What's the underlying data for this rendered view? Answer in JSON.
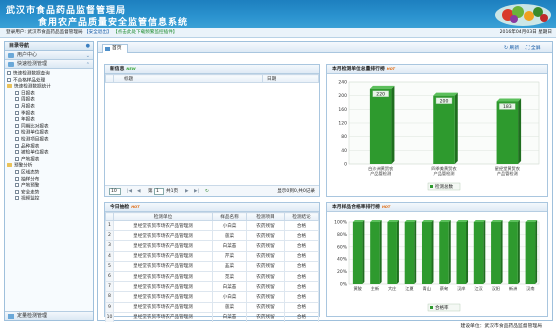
{
  "header": {
    "title_line1": "武汉市食品药品监督管理局",
    "title_line2": "食用农产品质量安全监管信息系统"
  },
  "infobar": {
    "login_user_prefix": "登录用户:",
    "login_user": "武汉市食品药品监督管理局",
    "safe_exit": "【安全退出】",
    "download_link": "【点击此处下载频繁监控插件】",
    "date": "2016年04月03日 星期日"
  },
  "sidebar": {
    "title": "目录导航",
    "user_center": "用户中心",
    "fast_manage": "快速检测管理",
    "tree": [
      {
        "label": "快速检测数据查询",
        "level": 1,
        "kind": "leaf"
      },
      {
        "label": "不合格样品处理",
        "level": 1,
        "kind": "leaf"
      },
      {
        "label": "快速检测数据统计",
        "level": 1,
        "kind": "folder"
      },
      {
        "label": "日报表",
        "level": 2,
        "kind": "leaf"
      },
      {
        "label": "周报表",
        "level": 2,
        "kind": "leaf"
      },
      {
        "label": "月报表",
        "level": 2,
        "kind": "leaf"
      },
      {
        "label": "季报表",
        "level": 2,
        "kind": "leaf"
      },
      {
        "label": "年报表",
        "level": 2,
        "kind": "leaf"
      },
      {
        "label": "同期比对报表",
        "level": 2,
        "kind": "leaf"
      },
      {
        "label": "检测单位报表",
        "level": 2,
        "kind": "leaf"
      },
      {
        "label": "检测项目报表",
        "level": 2,
        "kind": "leaf"
      },
      {
        "label": "品种报表",
        "level": 2,
        "kind": "leaf"
      },
      {
        "label": "被检单位报表",
        "level": 2,
        "kind": "leaf"
      },
      {
        "label": "产地报表",
        "level": 2,
        "kind": "leaf"
      },
      {
        "label": "预警分析",
        "level": 1,
        "kind": "folder"
      },
      {
        "label": "区域态势",
        "level": 2,
        "kind": "leaf"
      },
      {
        "label": "抽样分布",
        "level": 2,
        "kind": "leaf"
      },
      {
        "label": "产地预警",
        "level": 2,
        "kind": "leaf"
      },
      {
        "label": "安全走势",
        "level": 2,
        "kind": "leaf"
      },
      {
        "label": "视频监控",
        "level": 2,
        "kind": "leaf"
      }
    ],
    "bottom": "定量检测管理"
  },
  "main": {
    "tab_home": "首页",
    "refresh": "刷新",
    "fullscreen": "全屏"
  },
  "info_panel": {
    "title": "新信息",
    "new_tag": "NEW",
    "col_title": "标题",
    "col_date": "日期"
  },
  "pager": {
    "page_size": "10",
    "page_label": "第",
    "page_num": "1",
    "total": "共1页",
    "display": "显示0到0,共0记录"
  },
  "today_panel": {
    "title": "今日抽检",
    "hot_tag": "HOT",
    "columns": [
      "检测单位",
      "样品名称",
      "检测项目",
      "检测结论"
    ],
    "rows": [
      [
        "1",
        "皇经堂农贸市场农产品管理测",
        "小白菜",
        "农药残留",
        "合格"
      ],
      [
        "2",
        "皇经堂农贸市场农产品管理测",
        "菠菜",
        "农药残留",
        "合格"
      ],
      [
        "3",
        "皇经堂农贸市场农产品管理测",
        "白菜苔",
        "农药残留",
        "合格"
      ],
      [
        "4",
        "皇经堂农贸市场农产品管理测",
        "芹菜",
        "农药残留",
        "合格"
      ],
      [
        "5",
        "皇经堂农贸市场农产品管理测",
        "韭菜",
        "农药残留",
        "合格"
      ],
      [
        "6",
        "皇经堂农贸市场农产品管理测",
        "苋菜",
        "农药残留",
        "合格"
      ],
      [
        "7",
        "皇经堂农贸市场农产品管理测",
        "白菜苔",
        "农药残留",
        "合格"
      ],
      [
        "8",
        "皇经堂农贸市场农产品管理测",
        "小白菜",
        "农药残留",
        "合格"
      ],
      [
        "9",
        "皇经堂农贸市场农产品管理测",
        "菠菜",
        "农药残留",
        "合格"
      ],
      [
        "10",
        "皇经堂农贸市场农产品管理测",
        "白菜苔",
        "农药残留",
        "合格"
      ]
    ]
  },
  "rank_panel": {
    "title": "本月检测单位总量排行榜",
    "hot_tag": "HOT"
  },
  "rate_panel": {
    "title": "本月样品合格率排行榜",
    "hot_tag": "HOT"
  },
  "chart_data": [
    {
      "type": "bar",
      "categories": [
        "白沙洲黄贸农产品管检测",
        "四季美黄贸农产品管检测",
        "星经堂黄贸农产品管检测"
      ],
      "values": [
        220,
        200,
        183
      ],
      "ylim": [
        0,
        240
      ],
      "yticks": [
        0,
        40,
        80,
        120,
        160,
        200,
        240
      ],
      "legend": "检测总数",
      "legend_position": "bottom",
      "color": "#2e9a2e",
      "grid": true
    },
    {
      "type": "bar",
      "categories": [
        "黄陂",
        "东西湖",
        "大庄湖",
        "江夏",
        "青山",
        "蔡甸",
        "江岸",
        "江汉",
        "汉阳",
        "新洲",
        "汉南"
      ],
      "tick_labels": [
        "黄陂",
        "主新",
        "大庄",
        "江夏",
        "青山",
        "蔡甸",
        "汉岸",
        "江汉",
        "汉阳",
        "新洲",
        "汉南"
      ],
      "values": [
        100,
        100,
        100,
        100,
        100,
        100,
        100,
        100,
        100,
        100,
        100
      ],
      "ylim": [
        0,
        100
      ],
      "yticks": [
        "0%",
        "20%",
        "40%",
        "60%",
        "80%",
        "100%"
      ],
      "legend": "合格率",
      "legend_position": "bottom",
      "color": "#2e9a2e",
      "grid": true
    }
  ],
  "footer": {
    "text": "建设单位：武汉市食品药品监督管理局"
  }
}
